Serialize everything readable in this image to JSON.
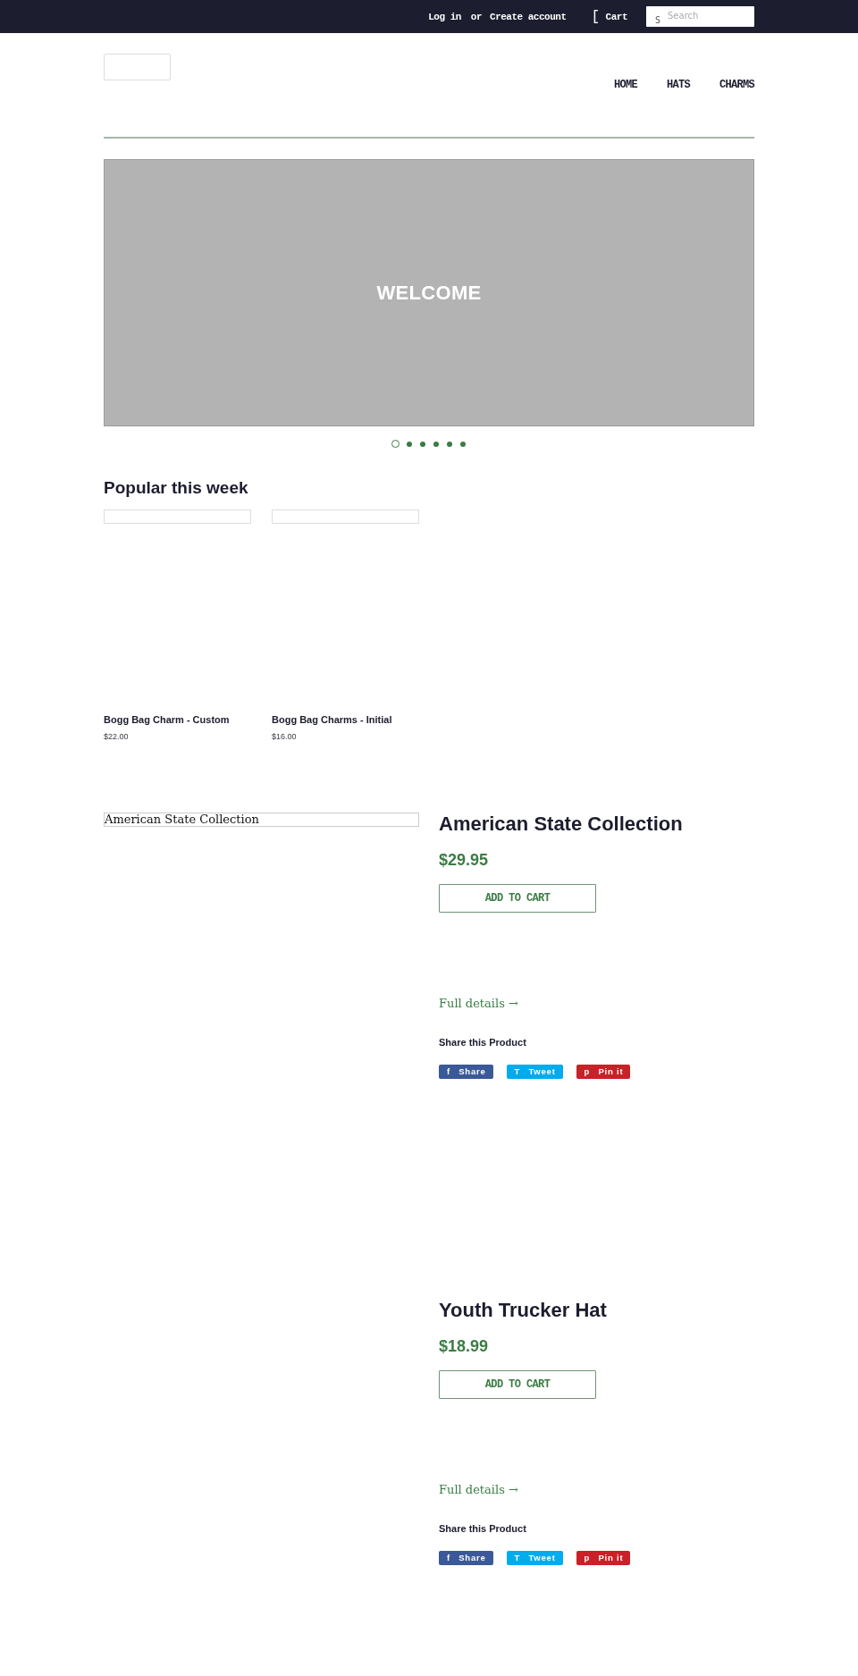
{
  "top_bar": {
    "login": "Log in",
    "separator": "or",
    "register": "Create account",
    "cart": {
      "icon": "[",
      "label": "Cart"
    },
    "search": {
      "icon": "S",
      "placeholder": "Search"
    }
  },
  "header": {
    "nav": [
      {
        "label": "HOME"
      },
      {
        "label": "HATS"
      },
      {
        "label": "CHARMS"
      }
    ]
  },
  "hero": {
    "title": "WELCOME",
    "dots": [
      {
        "selected": true
      },
      {
        "selected": false
      },
      {
        "selected": false
      },
      {
        "selected": false
      },
      {
        "selected": false
      },
      {
        "selected": false
      }
    ]
  },
  "popular": {
    "heading": "Popular this week",
    "products": [
      {
        "title": "Bogg Bag Charm - Custom",
        "price": "$22.00"
      },
      {
        "title": "Bogg Bag Charms - Initial",
        "price": "$16.00"
      }
    ]
  },
  "featured_products": [
    {
      "image_alt": "American State Collection",
      "title": "American State Collection",
      "price": "$29.95",
      "button": "ADD TO CART",
      "details_link": "Full details →",
      "share_heading": "Share this Product",
      "share_buttons": [
        {
          "icon": "f",
          "label": "Share",
          "color": "#3b5998"
        },
        {
          "icon": "T",
          "label": "Tweet",
          "color": "#00aced"
        },
        {
          "icon": "p",
          "label": "Pin it",
          "color": "#cb2027"
        }
      ]
    },
    {
      "title": "Youth Trucker Hat",
      "price": "$18.99",
      "button": "ADD TO CART",
      "details_link": "Full details →",
      "share_heading": "Share this Product",
      "share_buttons": [
        {
          "icon": "f",
          "label": "Share",
          "color": "#3b5998"
        },
        {
          "icon": "T",
          "label": "Tweet",
          "color": "#00aced"
        },
        {
          "icon": "p",
          "label": "Pin it",
          "color": "#cb2027"
        }
      ]
    }
  ]
}
